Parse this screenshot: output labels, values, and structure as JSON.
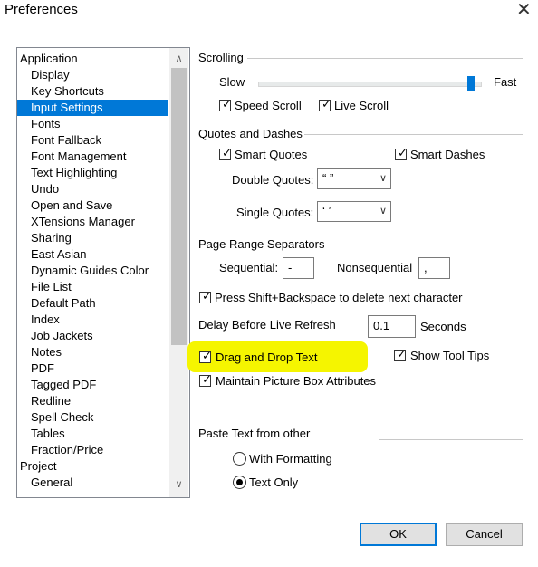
{
  "window": {
    "title": "Preferences",
    "close_glyph": "✕"
  },
  "tree": {
    "items": [
      {
        "label": "Application",
        "level": 0,
        "selected": false
      },
      {
        "label": "Display",
        "level": 1,
        "selected": false
      },
      {
        "label": "Key Shortcuts",
        "level": 1,
        "selected": false
      },
      {
        "label": "Input Settings",
        "level": 1,
        "selected": true
      },
      {
        "label": "Fonts",
        "level": 1,
        "selected": false
      },
      {
        "label": "Font Fallback",
        "level": 1,
        "selected": false
      },
      {
        "label": "Font Management",
        "level": 1,
        "selected": false
      },
      {
        "label": "Text Highlighting",
        "level": 1,
        "selected": false
      },
      {
        "label": "Undo",
        "level": 1,
        "selected": false
      },
      {
        "label": "Open and Save",
        "level": 1,
        "selected": false
      },
      {
        "label": "XTensions Manager",
        "level": 1,
        "selected": false
      },
      {
        "label": "Sharing",
        "level": 1,
        "selected": false
      },
      {
        "label": "East Asian",
        "level": 1,
        "selected": false
      },
      {
        "label": "Dynamic Guides Color",
        "level": 1,
        "selected": false
      },
      {
        "label": "File List",
        "level": 1,
        "selected": false
      },
      {
        "label": "Default Path",
        "level": 1,
        "selected": false
      },
      {
        "label": "Index",
        "level": 1,
        "selected": false
      },
      {
        "label": "Job Jackets",
        "level": 1,
        "selected": false
      },
      {
        "label": "Notes",
        "level": 1,
        "selected": false
      },
      {
        "label": "PDF",
        "level": 1,
        "selected": false
      },
      {
        "label": "Tagged PDF",
        "level": 1,
        "selected": false
      },
      {
        "label": "Redline",
        "level": 1,
        "selected": false
      },
      {
        "label": "Spell Check",
        "level": 1,
        "selected": false
      },
      {
        "label": "Tables",
        "level": 1,
        "selected": false
      },
      {
        "label": "Fraction/Price",
        "level": 1,
        "selected": false
      },
      {
        "label": "Project",
        "level": 0,
        "selected": false
      },
      {
        "label": "General",
        "level": 1,
        "selected": false
      }
    ],
    "scroll_up": "∧",
    "scroll_down": "∨"
  },
  "scrolling": {
    "heading": "Scrolling",
    "slow_label": "Slow",
    "fast_label": "Fast",
    "speed_fraction": 0.96,
    "speed_scroll": {
      "label": "Speed Scroll",
      "checked": true
    },
    "live_scroll": {
      "label": "Live Scroll",
      "checked": true
    }
  },
  "quotes": {
    "heading": "Quotes and Dashes",
    "smart_quotes": {
      "label": "Smart Quotes",
      "checked": true
    },
    "smart_dashes": {
      "label": "Smart Dashes",
      "checked": true
    },
    "double_label": "Double Quotes:",
    "double_value": "“ ”",
    "single_label": "Single Quotes:",
    "single_value": "‘ ’"
  },
  "page_range": {
    "heading": "Page Range Separators",
    "sequential_label": "Sequential:",
    "sequential_value": "-",
    "nonsequential_label": "Nonsequential",
    "nonsequential_value": ","
  },
  "options": {
    "shift_backspace": {
      "label": "Press Shift+Backspace to delete next character",
      "checked": true
    },
    "delay_label": "Delay Before Live Refresh",
    "delay_value": "0.1",
    "delay_unit": "Seconds",
    "drag_drop": {
      "label": "Drag and Drop Text",
      "checked": true
    },
    "tool_tips": {
      "label": "Show Tool Tips",
      "checked": true
    },
    "maintain_picture": {
      "label": "Maintain Picture Box Attributes",
      "checked": true
    }
  },
  "paste": {
    "heading": "Paste Text from other",
    "with_formatting": {
      "label": "With Formatting",
      "selected": false
    },
    "text_only": {
      "label": "Text Only",
      "selected": true
    }
  },
  "buttons": {
    "ok": "OK",
    "cancel": "Cancel"
  },
  "colors": {
    "accent": "#0078d7",
    "highlight": "#f5f500"
  },
  "check_glyph": "✓"
}
